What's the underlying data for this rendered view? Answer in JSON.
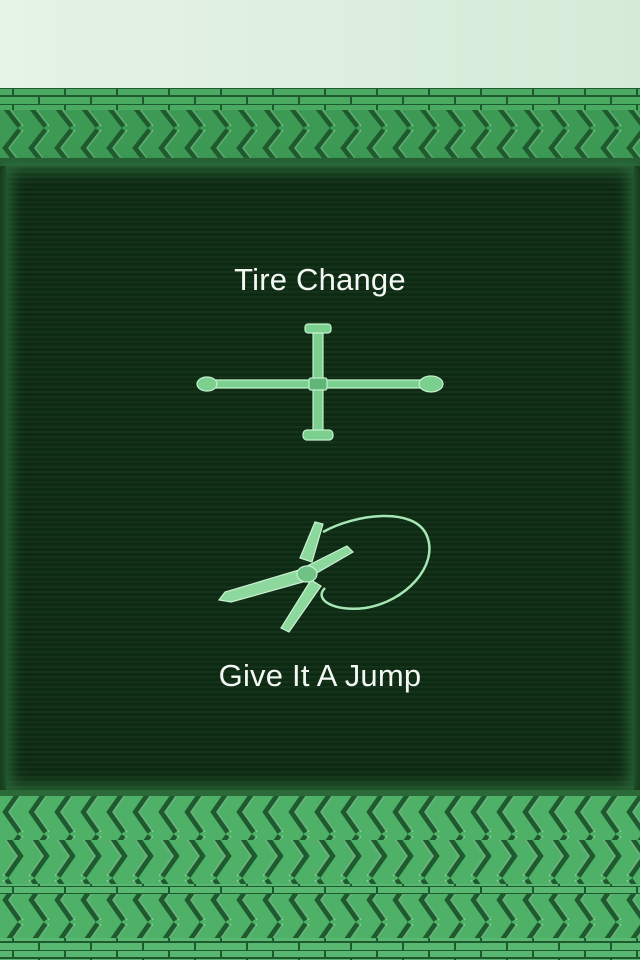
{
  "menu": {
    "items": [
      {
        "label": "Tire Change",
        "icon": "lug-wrench-icon"
      },
      {
        "label": "Give It A Jump",
        "icon": "jumper-cable-icon"
      }
    ]
  },
  "colors": {
    "top_bar": "#e2f1e4",
    "tread": "#3f9d57",
    "panel": "#0d2a12",
    "label": "#f4f8f4",
    "icon": "#7cd08f"
  }
}
